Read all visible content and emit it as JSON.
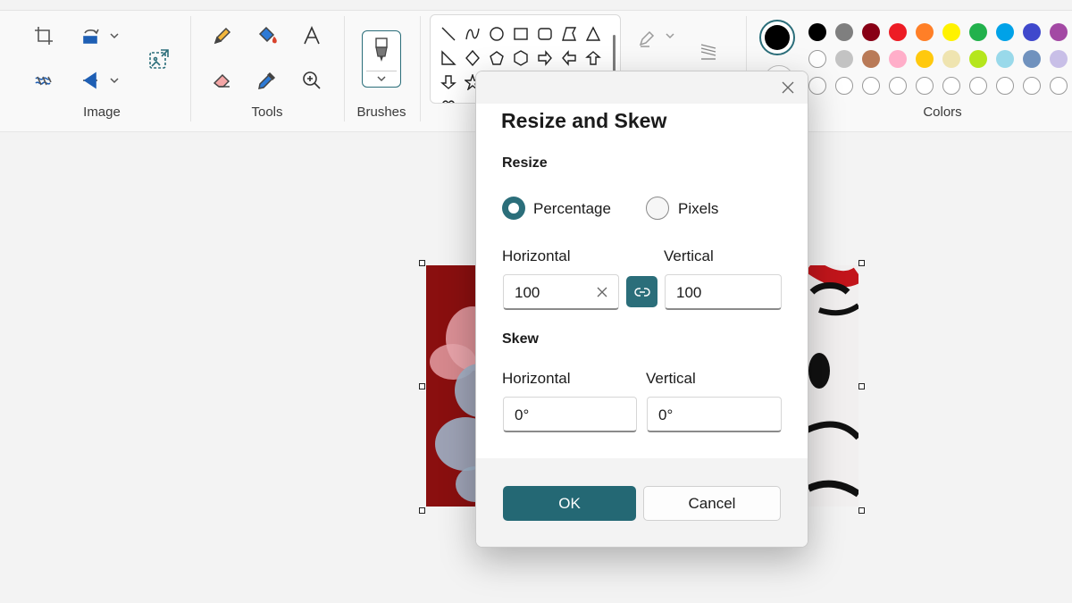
{
  "ribbon": {
    "groups": {
      "image": "Image",
      "tools": "Tools",
      "brushes": "Brushes",
      "colors": "Colors"
    }
  },
  "colors": {
    "current": "#000000",
    "row1": [
      "#000000",
      "#7f7f7f",
      "#880015",
      "#ed1c24",
      "#ff7f27",
      "#fff200",
      "#22b14c",
      "#00a2e8",
      "#3f48cc",
      "#a349a4"
    ],
    "row2": [
      "#ffffff",
      "#c3c3c3",
      "#b97a57",
      "#ffaec9",
      "#ffc90e",
      "#efe4b0",
      "#b5e61d",
      "#99d9ea",
      "#7092be",
      "#c8bfe7"
    ],
    "accent": "#2b6e7a"
  },
  "dialog": {
    "title": "Resize and Skew",
    "resize": {
      "label": "Resize",
      "percentage_label": "Percentage",
      "pixels_label": "Pixels",
      "selected": "percentage",
      "horizontal_label": "Horizontal",
      "vertical_label": "Vertical",
      "horizontal_value": "100",
      "vertical_value": "100"
    },
    "skew": {
      "label": "Skew",
      "horizontal_label": "Horizontal",
      "vertical_label": "Vertical",
      "horizontal_value": "0°",
      "vertical_value": "0°"
    },
    "ok_label": "OK",
    "cancel_label": "Cancel"
  }
}
